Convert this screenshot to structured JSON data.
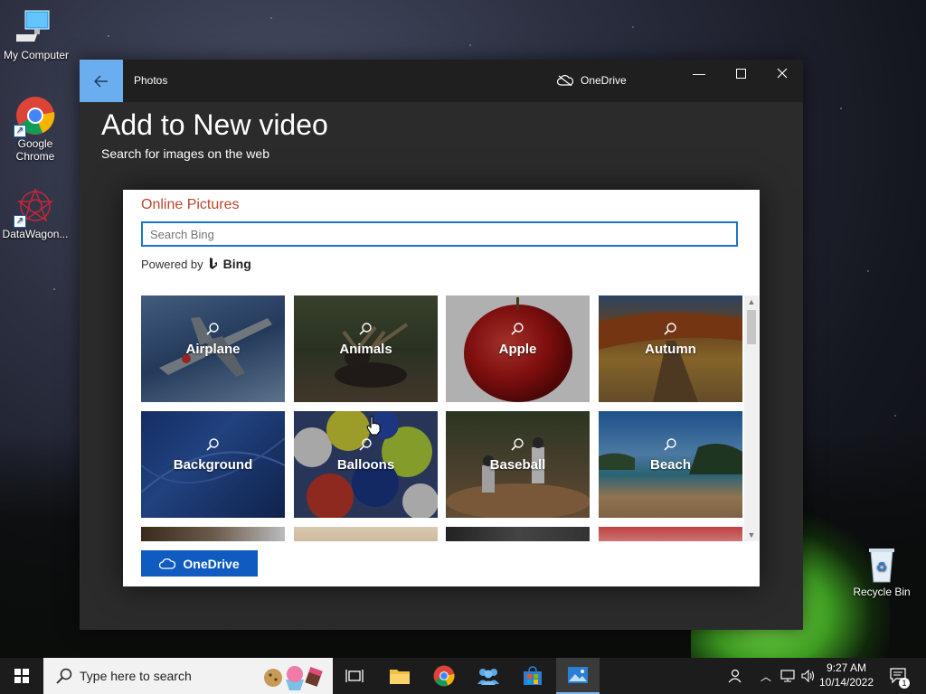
{
  "desktop": {
    "icons": [
      {
        "label": "My Computer"
      },
      {
        "label": "Google Chrome"
      },
      {
        "label": "DataWagon..."
      },
      {
        "label": "Recycle Bin"
      }
    ]
  },
  "window": {
    "app_name": "Photos",
    "onedrive_status": "OneDrive",
    "heading": "Add to New video",
    "subheading": "Search for images on the web"
  },
  "dialog": {
    "title": "Online Pictures",
    "search_placeholder": "Search Bing",
    "powered_by": "Powered by",
    "bing": "Bing",
    "categories": [
      {
        "label": "Airplane"
      },
      {
        "label": "Animals"
      },
      {
        "label": "Apple"
      },
      {
        "label": "Autumn"
      },
      {
        "label": "Background"
      },
      {
        "label": "Balloons"
      },
      {
        "label": "Baseball"
      },
      {
        "label": "Beach"
      }
    ],
    "onedrive_button": "OneDrive"
  },
  "taskbar": {
    "search_placeholder": "Type here to search",
    "time": "9:27 AM",
    "date": "10/14/2022",
    "notification_count": "1"
  },
  "colors": {
    "accent": "#0f5bbf",
    "dialog_title": "#b8462d",
    "back_button": "#6aaeef"
  }
}
